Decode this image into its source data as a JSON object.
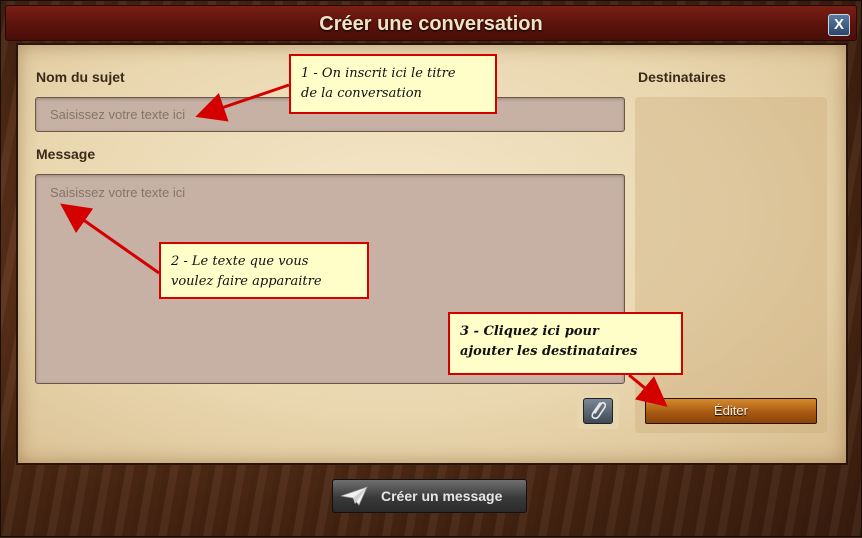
{
  "window": {
    "title": "Créer une conversation",
    "close_label": "X"
  },
  "form": {
    "subject_label": "Nom du sujet",
    "subject_placeholder": "Saisissez votre texte ici",
    "message_label": "Message",
    "message_placeholder": "Saisissez votre texte ici",
    "recipients_label": "Destinataires",
    "edit_button": "Éditer",
    "attach_icon": "paperclip-icon"
  },
  "footer": {
    "create_button": "Créer un message",
    "create_icon": "paper-plane-icon"
  },
  "annotations": [
    {
      "line1": "1 - On inscrit ici le titre",
      "line2": "de la conversation"
    },
    {
      "line1": "2 - Le texte que vous",
      "line2": "voulez faire apparaitre"
    },
    {
      "line1": "3 - Cliquez ici pour",
      "line2": "ajouter les destinataires"
    }
  ],
  "colors": {
    "title_bar": "#5a130c",
    "panel": "#ead7b0",
    "edit_button": "#a85a12",
    "annotation_border": "#d40000",
    "annotation_fill": "#fffdc8"
  }
}
